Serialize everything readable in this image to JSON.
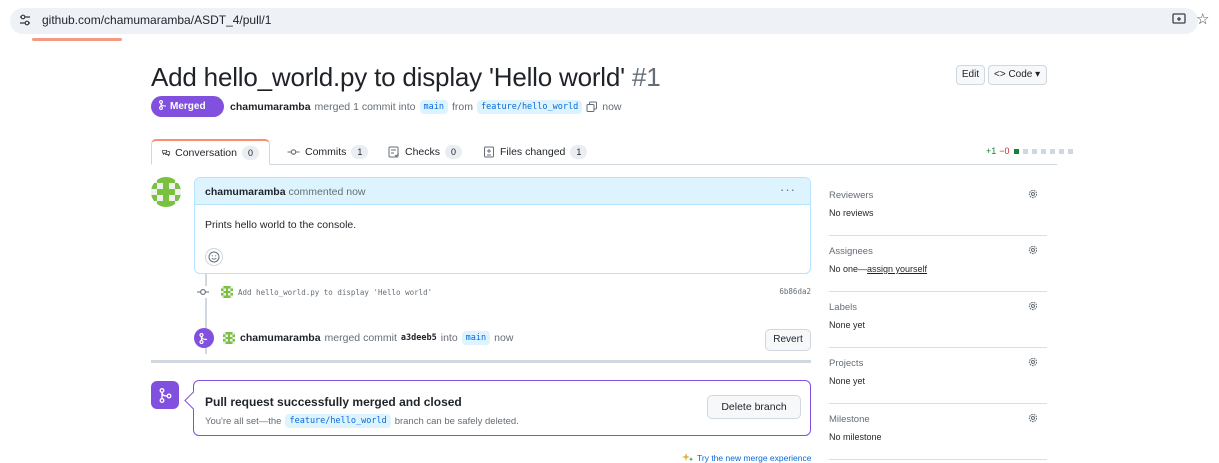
{
  "browser": {
    "url": "github.com/chamumaramba/ASDT_4/pull/1"
  },
  "pr": {
    "title": "Add hello_world.py to display 'Hello world'",
    "number": "#1",
    "edit_label": "Edit",
    "code_label": "<> Code ▾",
    "status_label": "Merged",
    "author": "chamumaramba",
    "merged_text": "merged 1 commit into",
    "base_branch": "main",
    "from_text": "from",
    "head_branch": "feature/hello_world",
    "time": "now"
  },
  "tabs": [
    {
      "label": "Conversation",
      "count": "0"
    },
    {
      "label": "Commits",
      "count": "1"
    },
    {
      "label": "Checks",
      "count": "0"
    },
    {
      "label": "Files changed",
      "count": "1"
    }
  ],
  "diffstat": {
    "additions": "+1",
    "deletions": "−0"
  },
  "comment": {
    "author": "chamumaramba",
    "action": "commented now",
    "body": "Prints hello world to the console."
  },
  "commit": {
    "message": "Add hello_world.py to display 'Hello world'",
    "sha": "6b86da2"
  },
  "merge_event": {
    "author": "chamumaramba",
    "text": "merged commit",
    "sha": "a3deeb5",
    "into": "into",
    "branch": "main",
    "time": "now",
    "revert_label": "Revert"
  },
  "merged_box": {
    "title": "Pull request successfully merged and closed",
    "sub_prefix": "You're all set—the",
    "branch": "feature/hello_world",
    "sub_suffix": "branch can be safely deleted.",
    "delete_label": "Delete branch",
    "try_label": "Try the new merge experience"
  },
  "sidebar": [
    {
      "title": "Reviewers",
      "value": "No reviews"
    },
    {
      "title": "Assignees",
      "value": "No one—",
      "link": "assign yourself"
    },
    {
      "title": "Labels",
      "value": "None yet"
    },
    {
      "title": "Projects",
      "value": "None yet"
    },
    {
      "title": "Milestone",
      "value": "No milestone"
    }
  ],
  "colors": {
    "merged_purple": "#8250df",
    "link_blue": "#0969da",
    "add_green": "#1a7f37",
    "tab_accent": "#fd8c73"
  }
}
